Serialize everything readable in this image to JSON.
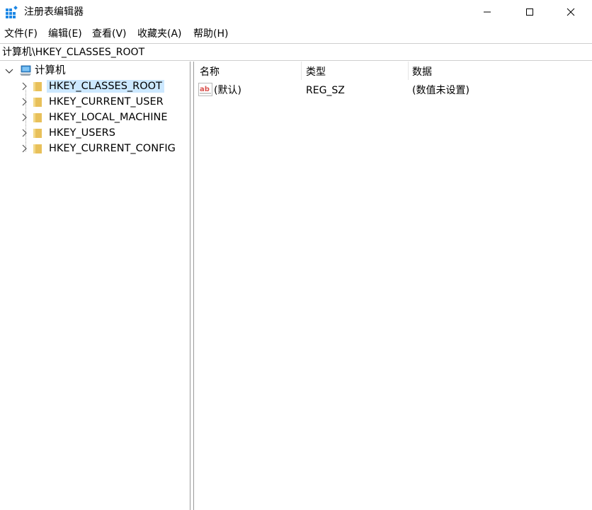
{
  "window": {
    "title": "注册表编辑器",
    "buttons": [
      "minimize",
      "maximize",
      "close"
    ]
  },
  "menu": [
    {
      "label": "文件(F)"
    },
    {
      "label": "编辑(E)"
    },
    {
      "label": "查看(V)"
    },
    {
      "label": "收藏夹(A)"
    },
    {
      "label": "帮助(H)"
    }
  ],
  "address": "计算机\\HKEY_CLASSES_ROOT",
  "tree": {
    "root": {
      "label": "计算机",
      "icon": "computer-icon",
      "expanded": true
    },
    "keys": [
      {
        "label": "HKEY_CLASSES_ROOT",
        "selected": true
      },
      {
        "label": "HKEY_CURRENT_USER",
        "selected": false
      },
      {
        "label": "HKEY_LOCAL_MACHINE",
        "selected": false
      },
      {
        "label": "HKEY_USERS",
        "selected": false
      },
      {
        "label": "HKEY_CURRENT_CONFIG",
        "selected": false
      }
    ]
  },
  "list": {
    "columns": [
      "名称",
      "类型",
      "数据"
    ],
    "rows": [
      {
        "name": "(默认)",
        "type": "REG_SZ",
        "data": "(数值未设置)",
        "icon": "string-value-icon"
      }
    ]
  },
  "colors": {
    "selection": "#cce8ff",
    "folder": "#e8c05a",
    "app_icon": "#1e88e5",
    "value_icon": "#d9534f"
  }
}
